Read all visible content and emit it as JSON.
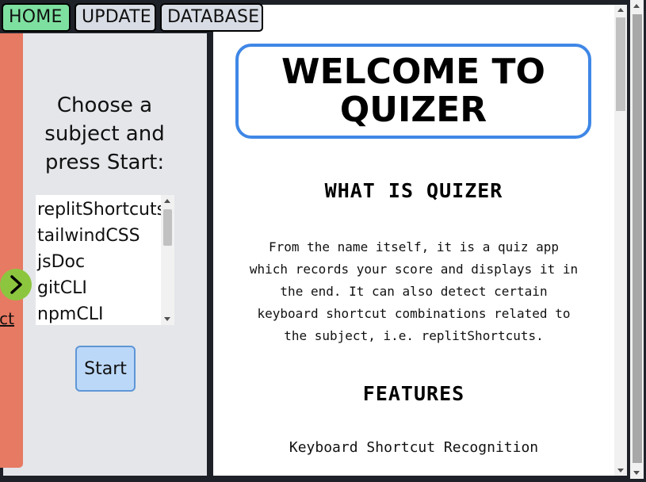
{
  "tabs": [
    {
      "label": "HOME",
      "active": true
    },
    {
      "label": "UPDATE",
      "active": false
    },
    {
      "label": "DATABASE",
      "active": false
    }
  ],
  "sidebar": {
    "prompt": "Choose a subject and press Start:",
    "subjects": [
      "replitShortcuts",
      "tailwindCSS",
      "jsDoc",
      "gitCLI",
      "npmCLI"
    ],
    "start_label": "Start",
    "drawer_link_fragment": "ct",
    "drawer_toggle_icon": "chevron-right-icon"
  },
  "main": {
    "welcome_title": "WELCOME TO QUIZER",
    "what_heading": "WHAT IS QUIZER",
    "what_text": "From the name itself, it is a quiz app which records your score and displays it in the end. It can also detect certain keyboard shortcut combinations related to the subject, i.e. replitShortcuts.",
    "features_heading": "FEATURES",
    "features": [
      "Keyboard Shortcut Recognition"
    ]
  },
  "colors": {
    "active_tab": "#7ee0a0",
    "inactive_tab": "#d8dce4",
    "welcome_border": "#3f87e6",
    "start_button": "#bcd8f8",
    "drawer": "#e77a63",
    "toggle": "#8cc63f"
  }
}
